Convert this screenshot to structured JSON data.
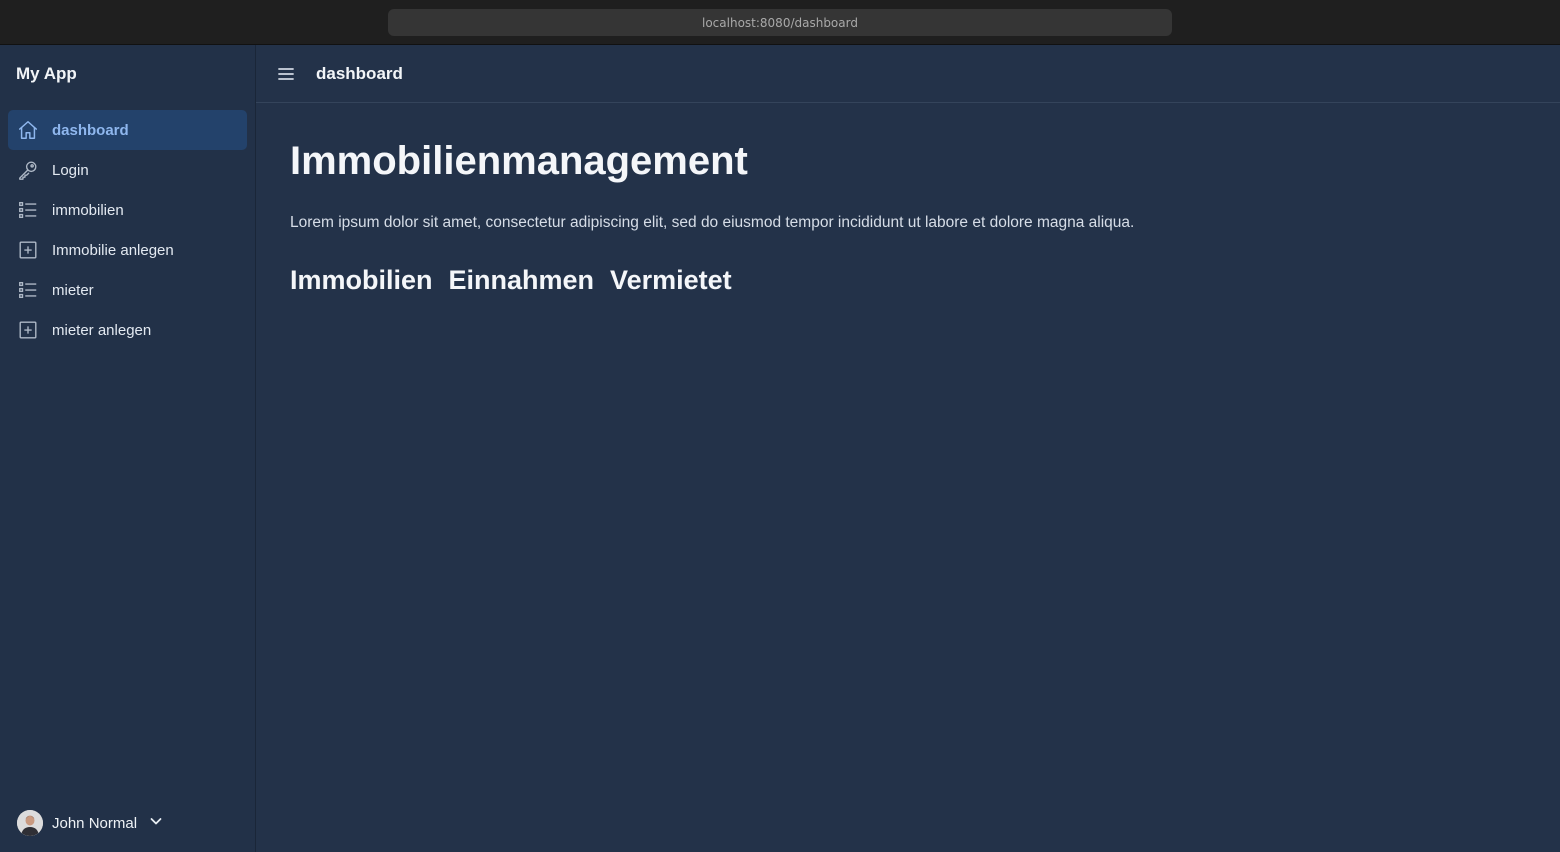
{
  "browser": {
    "url": "localhost:8080/dashboard"
  },
  "sidebar": {
    "app_title": "My App",
    "items": [
      {
        "label": "dashboard",
        "icon": "home-icon",
        "active": true
      },
      {
        "label": "Login",
        "icon": "key-icon",
        "active": false
      },
      {
        "label": "immobilien",
        "icon": "list-icon",
        "active": false
      },
      {
        "label": "Immobilie anlegen",
        "icon": "plus-square-icon",
        "active": false
      },
      {
        "label": "mieter",
        "icon": "list-icon",
        "active": false
      },
      {
        "label": "mieter anlegen",
        "icon": "plus-square-icon",
        "active": false
      }
    ],
    "user": {
      "name": "John Normal"
    }
  },
  "header": {
    "title": "dashboard"
  },
  "main": {
    "heading": "Immobilienmanagement",
    "paragraph": "Lorem ipsum dolor sit amet, consectetur adipiscing elit, sed do eiusmod tempor incididunt ut labore et dolore magna aliqua.",
    "subheadings": [
      "Immobilien",
      "Einnahmen",
      "Vermietet"
    ]
  },
  "colors": {
    "background": "#233249",
    "sidebar": "#223148",
    "active_item": "#23426b",
    "active_text": "#8fb7ee"
  }
}
